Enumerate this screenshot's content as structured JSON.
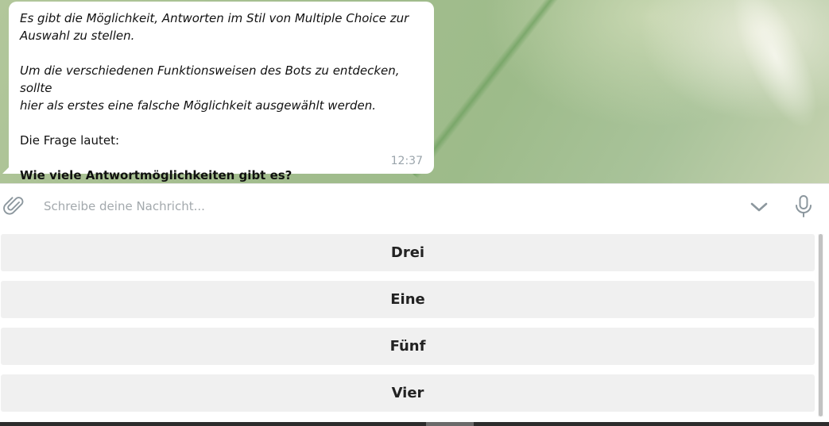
{
  "message": {
    "line1": "Es gibt die Möglichkeit, Antworten im Stil von Multiple Choice zur",
    "line2": "Auswahl zu stellen.",
    "line3": "Um die verschiedenen Funktionsweisen des Bots zu entdecken, sollte",
    "line4": "hier als erstes eine falsche Möglichkeit ausgewählt werden.",
    "line5": "Die Frage lautet:",
    "question": "Wie viele Antwortmöglichkeiten gibt es?",
    "time": "12:37"
  },
  "input": {
    "placeholder": "Schreibe deine Nachricht...",
    "value": ""
  },
  "icons": {
    "attach": "paperclip-icon",
    "toggle_keyboard": "chevron-down-icon",
    "voice": "microphone-icon"
  },
  "keyboard": {
    "buttons": [
      "Drei",
      "Eine",
      "Fünf",
      "Vier"
    ]
  },
  "colors": {
    "bubble": "#ffffff",
    "button_bg": "#f0f0f0",
    "timestamp": "#9aa4ab",
    "placeholder": "#a3a9ad"
  }
}
